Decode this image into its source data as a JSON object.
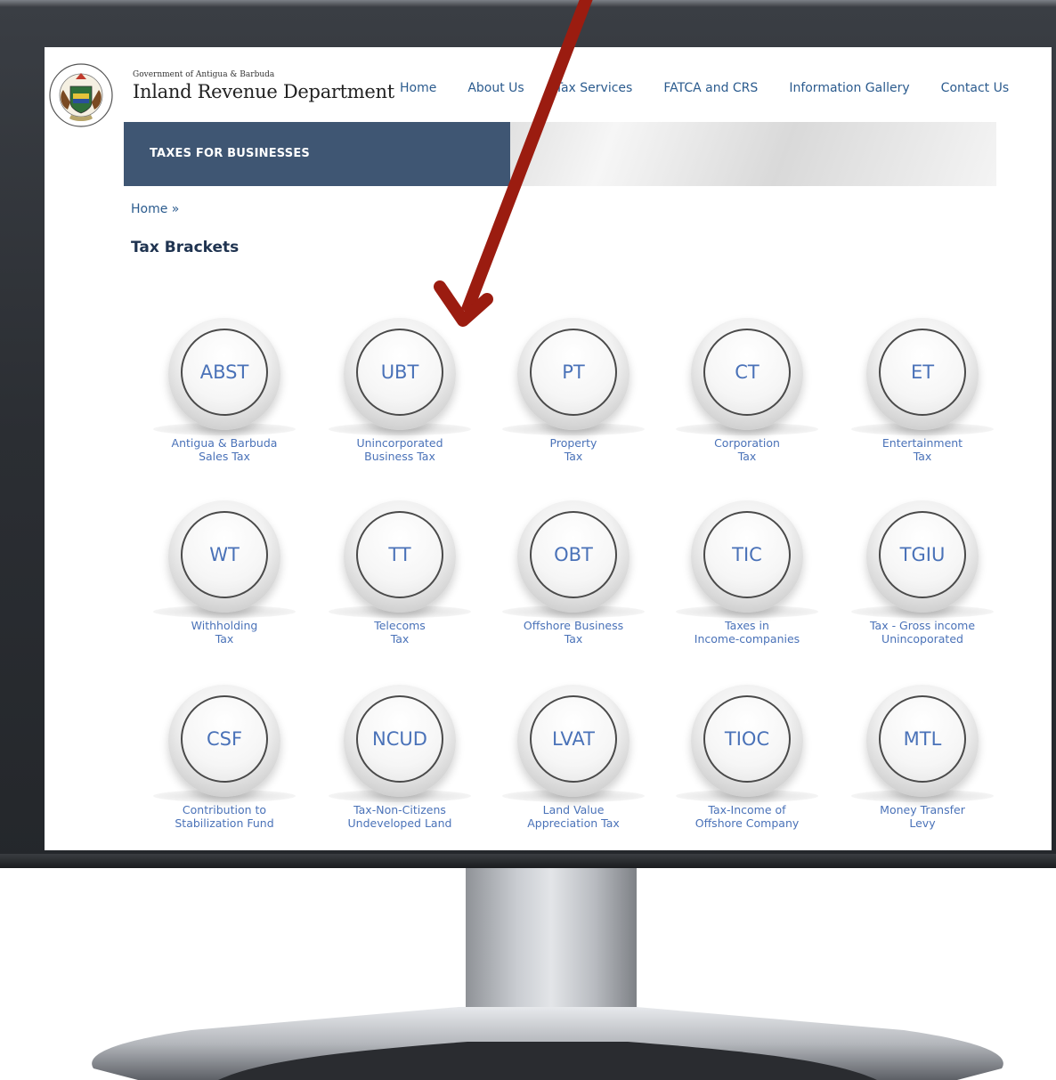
{
  "header": {
    "government_line": "Government of Antigua & Barbuda",
    "department_name": "Inland Revenue Department",
    "logo_icon": "antigua-barbuda-coat-of-arms",
    "logo_text": "Antigua and Barbuda Inland Revenue Department"
  },
  "nav": {
    "items": [
      {
        "label": "Home"
      },
      {
        "label": "About Us"
      },
      {
        "label": "Tax Services"
      },
      {
        "label": "FATCA and CRS"
      },
      {
        "label": "Information Gallery"
      },
      {
        "label": "Contact Us"
      }
    ]
  },
  "banner": {
    "label": "TAXES FOR BUSINESSES"
  },
  "breadcrumb": {
    "label": "Home »"
  },
  "page": {
    "title": "Tax Brackets"
  },
  "taxes": [
    {
      "code": "ABST",
      "line1": "Antigua & Barbuda",
      "line2": "Sales Tax"
    },
    {
      "code": "UBT",
      "line1": "Unincorporated",
      "line2": "Business Tax"
    },
    {
      "code": "PT",
      "line1": "Property",
      "line2": "Tax"
    },
    {
      "code": "CT",
      "line1": "Corporation",
      "line2": "Tax"
    },
    {
      "code": "ET",
      "line1": "Entertainment",
      "line2": "Tax"
    },
    {
      "code": "WT",
      "line1": "Withholding",
      "line2": "Tax"
    },
    {
      "code": "TT",
      "line1": "Telecoms",
      "line2": "Tax"
    },
    {
      "code": "OBT",
      "line1": "Offshore Business",
      "line2": "Tax"
    },
    {
      "code": "TIC",
      "line1": "Taxes in",
      "line2": "Income-companies"
    },
    {
      "code": "TGIU",
      "line1": "Tax - Gross income",
      "line2": "Unincoporated"
    },
    {
      "code": "CSF",
      "line1": "Contribution to",
      "line2": "Stabilization Fund"
    },
    {
      "code": "NCUD",
      "line1": "Tax-Non-Citizens",
      "line2": "Undeveloped Land"
    },
    {
      "code": "LVAT",
      "line1": "Land Value",
      "line2": "Appreciation Tax"
    },
    {
      "code": "TIOC",
      "line1": "Tax-Income of",
      "line2": "Offshore Company"
    },
    {
      "code": "MTL",
      "line1": "Money Transfer",
      "line2": "Levy"
    }
  ],
  "colors": {
    "link": "#2b5b8e",
    "badge_text": "#4a72b8",
    "banner_tab": "#3f5673",
    "annotation_arrow": "#9b1c10"
  },
  "annotation": {
    "icon": "red-pointer-arrow-icon"
  }
}
